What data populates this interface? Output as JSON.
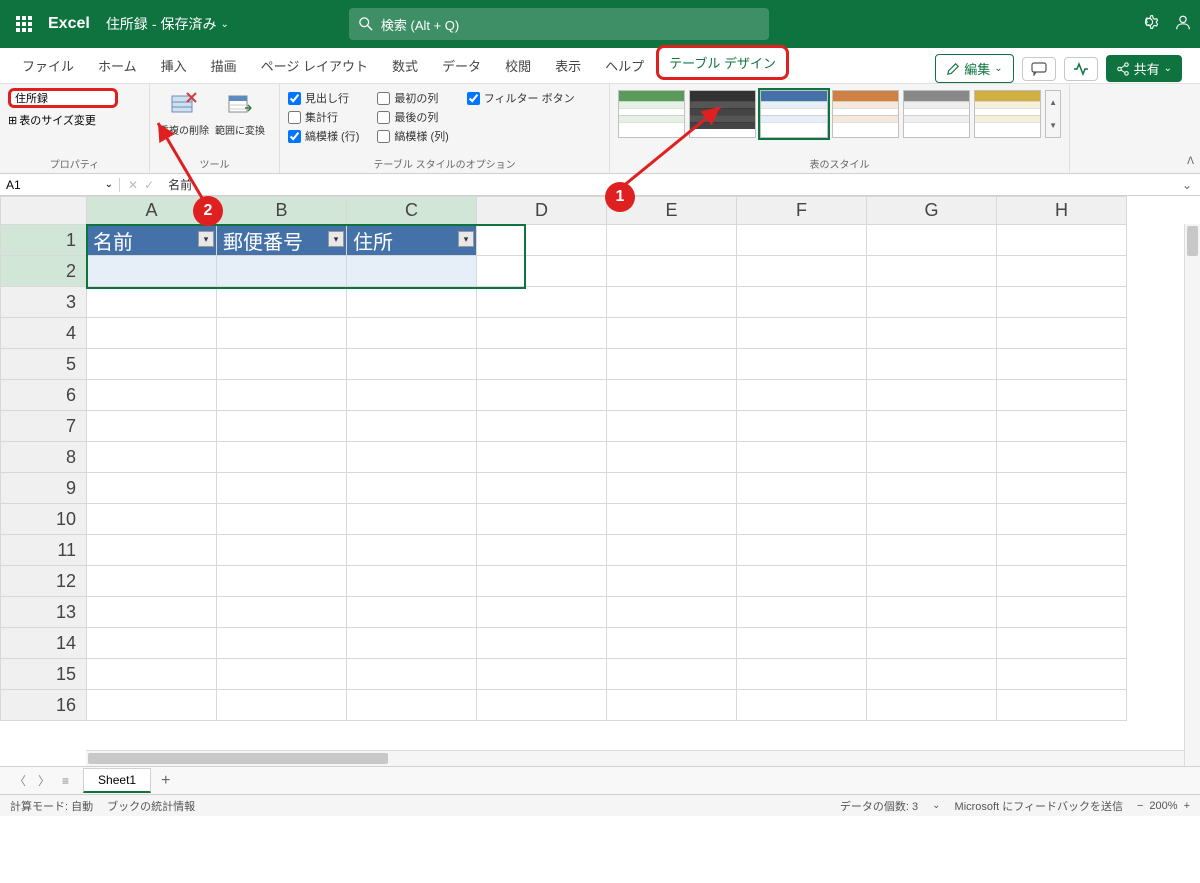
{
  "title": {
    "app_name": "Excel",
    "doc_name": "住所録",
    "save_status": "保存済み",
    "search_placeholder": "検索 (Alt + Q)"
  },
  "tabs": {
    "file": "ファイル",
    "home": "ホーム",
    "insert": "挿入",
    "draw": "描画",
    "layout": "ページ レイアウト",
    "formulas": "数式",
    "data": "データ",
    "review": "校閲",
    "view": "表示",
    "help": "ヘルプ",
    "table_design": "テーブル デザイン"
  },
  "ribbon_right": {
    "edit": "編集",
    "share": "共有"
  },
  "ribbon": {
    "properties_label": "プロパティ",
    "table_name_value": "住所録",
    "resize": "表のサイズ変更",
    "tools_label": "ツール",
    "remove_dup": "重複の削除",
    "convert_range": "範囲に変換",
    "options_label": "テーブル スタイルのオプション",
    "opt_header": "見出し行",
    "opt_total": "集計行",
    "opt_banded_row": "縞模様 (行)",
    "opt_first_col": "最初の列",
    "opt_last_col": "最後の列",
    "opt_banded_col": "縞模様 (列)",
    "opt_filter": "フィルター ボタン",
    "styles_label": "表のスタイル"
  },
  "fx": {
    "name_box": "A1",
    "value": "名前"
  },
  "cols": [
    "A",
    "B",
    "C",
    "D",
    "E",
    "F",
    "G",
    "H"
  ],
  "rows": [
    "1",
    "2",
    "3",
    "4",
    "5",
    "6",
    "7",
    "8",
    "9",
    "10",
    "11",
    "12",
    "13",
    "14",
    "15",
    "16"
  ],
  "table_headers": [
    "名前",
    "郵便番号",
    "住所"
  ],
  "annotations": {
    "n1": "1",
    "n2": "2"
  },
  "sheet_tabs": {
    "sheet1": "Sheet1"
  },
  "status": {
    "calc_mode": "計算モード: 自動",
    "stats": "ブックの統計情報",
    "count": "データの個数: 3",
    "feedback": "Microsoft にフィードバックを送信",
    "zoom": "200%"
  }
}
